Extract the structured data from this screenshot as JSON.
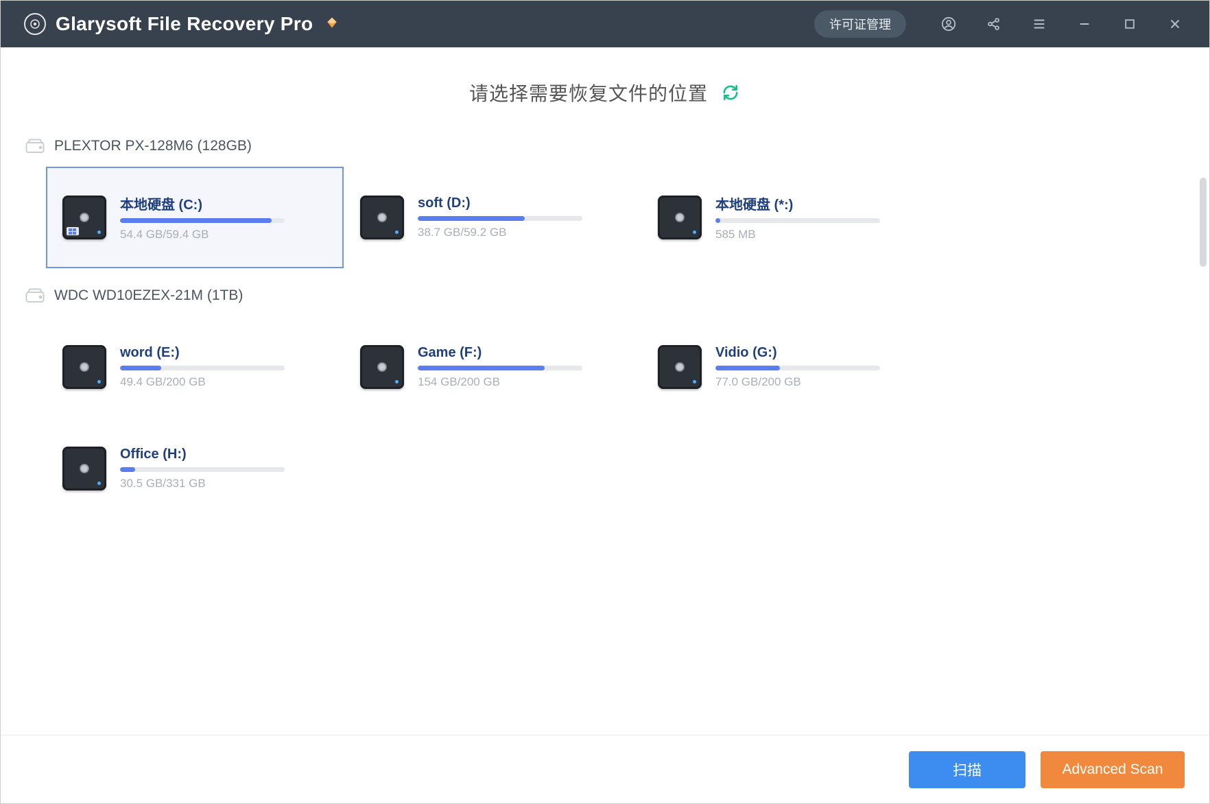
{
  "titlebar": {
    "app_title": "Glarysoft File Recovery Pro",
    "license_button": "许可证管理"
  },
  "heading": {
    "text": "请选择需要恢复文件的位置"
  },
  "disks": [
    {
      "name": "PLEXTOR PX-128M6 (128GB)",
      "partitions": [
        {
          "label": "本地硬盘 (C:)",
          "size_text": "54.4 GB/59.4 GB",
          "fill_pct": 92,
          "selected": true,
          "os": true
        },
        {
          "label": "soft (D:)",
          "size_text": "38.7 GB/59.2 GB",
          "fill_pct": 65,
          "selected": false,
          "os": false
        },
        {
          "label": "本地硬盘 (*:)",
          "size_text": "585 MB",
          "fill_pct": 3,
          "selected": false,
          "os": false
        }
      ]
    },
    {
      "name": "WDC WD10EZEX-21M (1TB)",
      "partitions": [
        {
          "label": "word (E:)",
          "size_text": "49.4 GB/200 GB",
          "fill_pct": 25,
          "selected": false,
          "os": false
        },
        {
          "label": "Game (F:)",
          "size_text": "154 GB/200 GB",
          "fill_pct": 77,
          "selected": false,
          "os": false
        },
        {
          "label": "Vidio (G:)",
          "size_text": "77.0 GB/200 GB",
          "fill_pct": 39,
          "selected": false,
          "os": false
        },
        {
          "label": "Office (H:)",
          "size_text": "30.5 GB/331 GB",
          "fill_pct": 9,
          "selected": false,
          "os": false
        }
      ]
    }
  ],
  "footer": {
    "scan_label": "扫描",
    "advanced_label": "Advanced Scan"
  }
}
